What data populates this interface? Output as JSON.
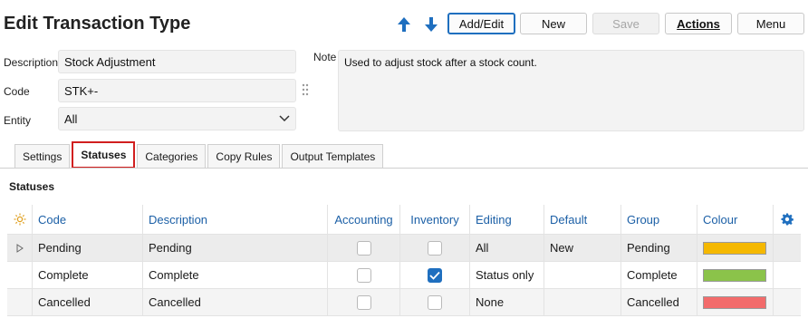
{
  "header": {
    "title": "Edit Transaction Type"
  },
  "toolbar": {
    "add_edit": "Add/Edit",
    "new": "New",
    "save": "Save",
    "actions": "Actions",
    "menu": "Menu"
  },
  "form": {
    "description_label": "Description",
    "description_value": "Stock Adjustment",
    "code_label": "Code",
    "code_value": "STK+-",
    "entity_label": "Entity",
    "entity_value": "All",
    "note_label": "Note",
    "note_value": "Used to adjust stock after a stock count."
  },
  "tabs": [
    {
      "label": "Settings",
      "active": false
    },
    {
      "label": "Statuses",
      "active": true
    },
    {
      "label": "Categories",
      "active": false
    },
    {
      "label": "Copy Rules",
      "active": false
    },
    {
      "label": "Output Templates",
      "active": false
    }
  ],
  "statuses": {
    "section_title": "Statuses",
    "columns": [
      "Code",
      "Description",
      "Accounting",
      "Inventory",
      "Editing",
      "Default",
      "Group",
      "Colour"
    ],
    "rows": [
      {
        "code": "Pending",
        "description": "Pending",
        "accounting": false,
        "inventory": false,
        "editing": "All",
        "default": "New",
        "group": "Pending",
        "colour": "#f5b800"
      },
      {
        "code": "Complete",
        "description": "Complete",
        "accounting": false,
        "inventory": true,
        "editing": "Status only",
        "default": "",
        "group": "Complete",
        "colour": "#8bc34a"
      },
      {
        "code": "Cancelled",
        "description": "Cancelled",
        "accounting": false,
        "inventory": false,
        "editing": "None",
        "default": "",
        "group": "Cancelled",
        "colour": "#f26b6b"
      }
    ]
  },
  "colors": {
    "accent": "#1f6fbf",
    "tab_highlight": "#d11f1f",
    "header_text": "#1b5fa6"
  }
}
